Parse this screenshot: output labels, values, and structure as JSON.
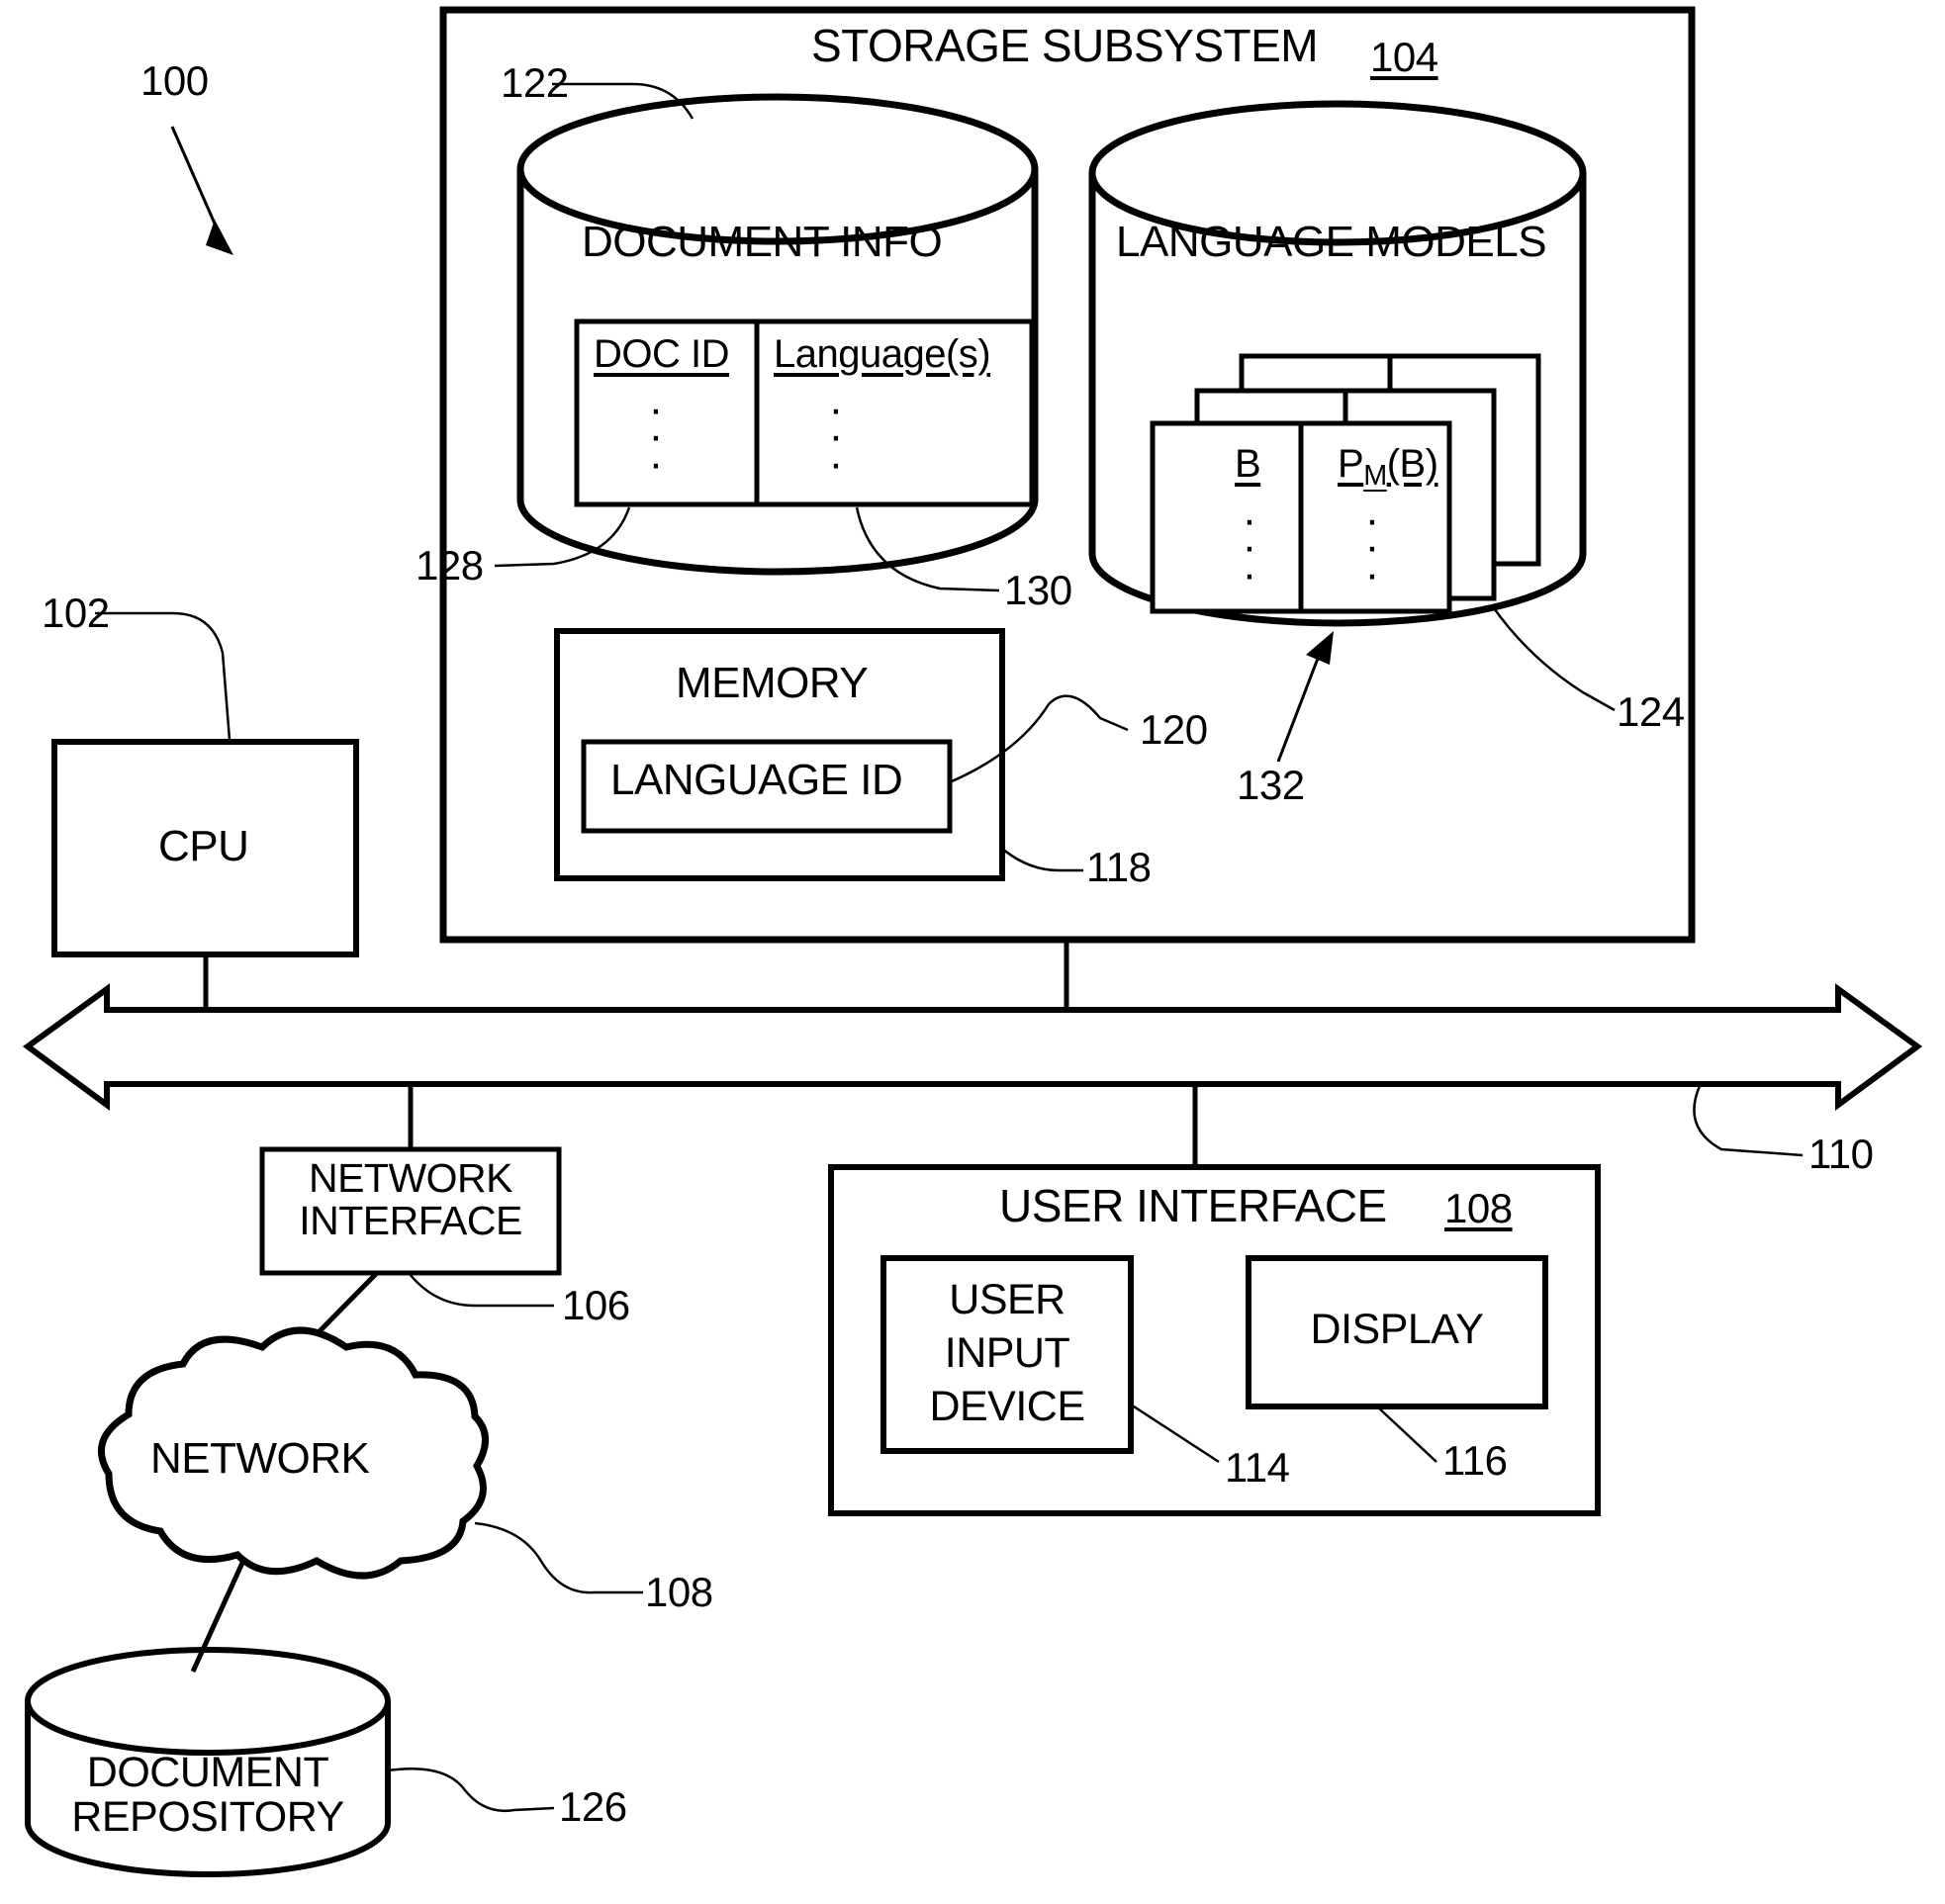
{
  "figure": {
    "ref_100": "100",
    "ref_102": "102",
    "ref_104": "104",
    "ref_106": "106",
    "ref_108_ui": "108",
    "ref_108_net": "108",
    "ref_110": "110",
    "ref_114": "114",
    "ref_116": "116",
    "ref_118": "118",
    "ref_120": "120",
    "ref_122": "122",
    "ref_124": "124",
    "ref_126": "126",
    "ref_128": "128",
    "ref_130": "130",
    "ref_132": "132"
  },
  "storage_subsystem": {
    "title": "STORAGE SUBSYSTEM",
    "ref": "104"
  },
  "document_info": {
    "title": "DOCUMENT INFO",
    "columns": [
      "DOC ID",
      "Language(s)"
    ],
    "rows_placeholder": "·\n·\n·"
  },
  "language_models": {
    "title": "LANGUAGE MODELS",
    "columns": [
      "B",
      "P",
      "M",
      "(B)"
    ],
    "col_left": "B",
    "col_right_base": "P",
    "col_right_sub": "M",
    "col_right_tail": "(B)",
    "rows_placeholder": "·\n·\n·"
  },
  "memory": {
    "title": "MEMORY",
    "inner_title": "LANGUAGE ID"
  },
  "cpu": {
    "label": "CPU"
  },
  "network_interface": {
    "line1": "NETWORK",
    "line2": "INTERFACE"
  },
  "network_cloud": {
    "label": "NETWORK"
  },
  "document_repository": {
    "line1": "DOCUMENT",
    "line2": "REPOSITORY"
  },
  "user_interface": {
    "title": "USER INTERFACE",
    "ref": "108",
    "user_input_device": {
      "line1": "USER",
      "line2": "INPUT",
      "line3": "DEVICE"
    },
    "display": {
      "label": "DISPLAY"
    }
  },
  "bus": {
    "name": "system-bus",
    "ref": "110"
  },
  "colors": {
    "stroke": "#000000",
    "background": "#ffffff"
  }
}
